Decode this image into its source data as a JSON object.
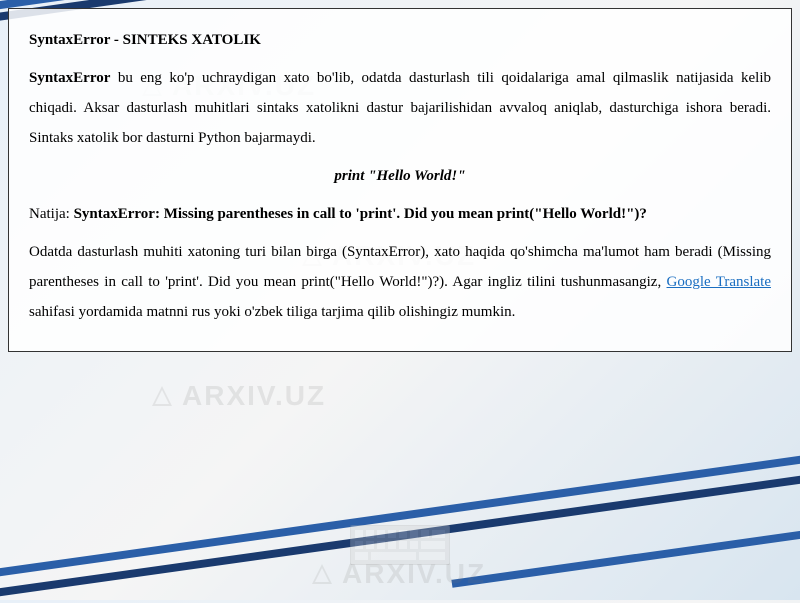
{
  "document": {
    "heading": "SyntaxError - SINTEKS XATOLIK",
    "intro_bold": "SyntaxError",
    "intro_rest": " bu eng ko'p uchraydigan xato bo'lib, odatda dasturlash tili qoidalariga amal qilmaslik natijasida kelib chiqadi. Aksar dasturlash muhitlari sintaks xatolikni dastur bajarilishidan avvaloq aniqlab, dasturchiga ishora beradi. Sintaks xatolik bor dasturni Python bajarmaydi.",
    "code_example": "print \"Hello World!\"",
    "result_label": "Natija: ",
    "result_bold": "SyntaxError: Missing parentheses in call to 'print'. Did you mean print(\"Hello World!\")?",
    "explanation_before_link": "Odatda dasturlash muhiti xatoning turi bilan birga (SyntaxError), xato haqida qo'shimcha ma'lumot ham beradi (Missing parentheses in call to 'print'. Did you mean print(\"Hello World!\")?). Agar ingliz tilini tushunmasangiz, ",
    "link_text": "Google Translate",
    "explanation_after_link": " sahifasi yordamida matnni rus yoki o'zbek tiliga tarjima qilib olishingiz mumkin."
  },
  "watermark": {
    "text": "ARXIV.UZ"
  }
}
